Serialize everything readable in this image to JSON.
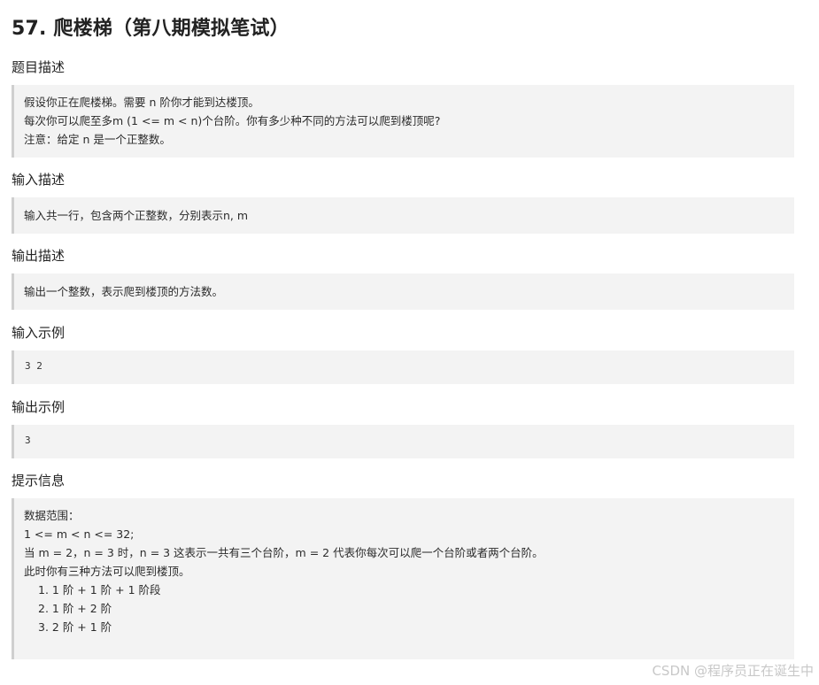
{
  "title": "57. 爬楼梯（第八期模拟笔试）",
  "sections": {
    "description": {
      "heading": "题目描述",
      "lines": [
        "假设你正在爬楼梯。需要 n 阶你才能到达楼顶。",
        "每次你可以爬至多m (1 <= m < n)个台阶。你有多少种不同的方法可以爬到楼顶呢?",
        "注意：给定 n 是一个正整数。"
      ]
    },
    "input": {
      "heading": "输入描述",
      "text": "输入共一行，包含两个正整数，分别表示n, m"
    },
    "output": {
      "heading": "输出描述",
      "text": "输出一个整数，表示爬到楼顶的方法数。"
    },
    "input_example": {
      "heading": "输入示例",
      "text": "3 2"
    },
    "output_example": {
      "heading": "输出示例",
      "text": "3"
    },
    "hint": {
      "heading": "提示信息",
      "lines": [
        "数据范围：",
        "1 <= m < n <= 32;",
        "当 m = 2，n = 3 时，n = 3 这表示一共有三个台阶，m = 2 代表你每次可以爬一个台阶或者两个台阶。",
        "此时你有三种方法可以爬到楼顶。"
      ],
      "items": [
        "1. 1 阶 + 1 阶 + 1 阶段",
        "2. 1 阶 + 2 阶",
        "3. 2 阶 + 1 阶"
      ]
    }
  },
  "watermark": "CSDN @程序员正在诞生中"
}
